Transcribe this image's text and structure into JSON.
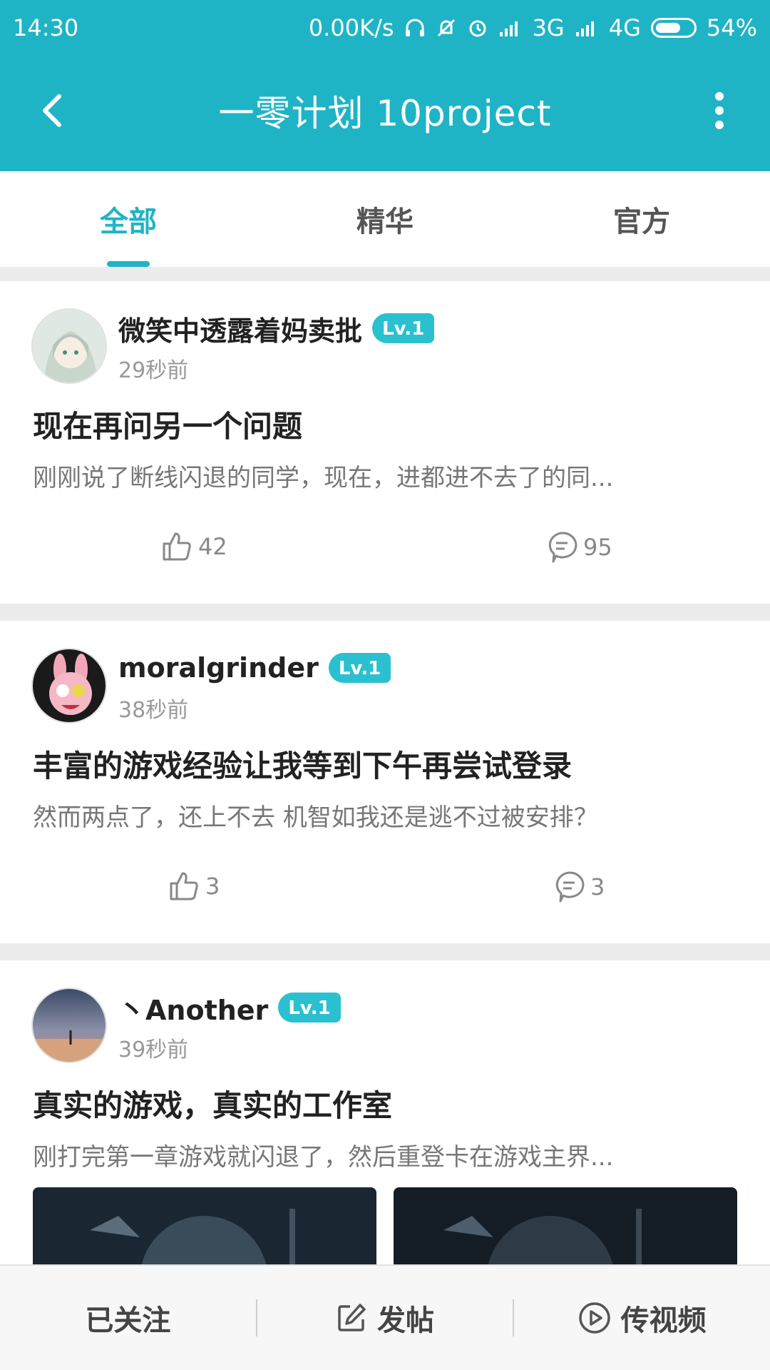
{
  "status_bar": {
    "time": "14:30",
    "net_speed": "0.00K/s",
    "network_3g": "3G",
    "network_4g": "4G",
    "battery": "54%"
  },
  "header": {
    "title": "一零计划 10project",
    "back_icon": "chevron-left-icon",
    "more_icon": "more-vertical-icon"
  },
  "tabs": [
    {
      "label": "全部",
      "active": true
    },
    {
      "label": "精华",
      "active": false
    },
    {
      "label": "官方",
      "active": false
    }
  ],
  "posts": [
    {
      "username": "微笑中透露着妈卖批",
      "level": "Lv.1",
      "time": "29秒前",
      "title": "现在再问另一个问题",
      "excerpt": "刚刚说了断线闪退的同学，现在，进都进不去了的同...",
      "likes": "42",
      "comments": "95"
    },
    {
      "username": "moralgrinder",
      "level": "Lv.1",
      "time": "38秒前",
      "title": "丰富的游戏经验让我等到下午再尝试登录",
      "excerpt": "然而两点了，还上不去 机智如我还是逃不过被安排？",
      "likes": "3",
      "comments": "3"
    },
    {
      "username": "丶Another",
      "level": "Lv.1",
      "time": "39秒前",
      "title": "真实的游戏，真实的工作室",
      "excerpt": "刚打完第一章游戏就闪退了，然后重登卡在游戏主界..."
    }
  ],
  "bottom_bar": {
    "follow": "已关注",
    "post": "发帖",
    "video": "传视频"
  },
  "colors": {
    "accent": "#1fb4c5",
    "level_badge": "#2bc0cf"
  }
}
